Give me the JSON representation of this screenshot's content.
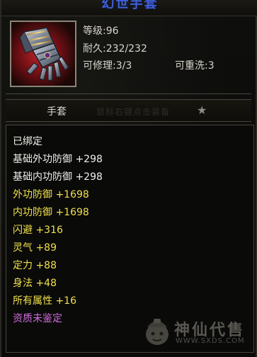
{
  "title": "幻世手套",
  "item": {
    "icon": "armored-gauntlet-icon",
    "level": "等级:96",
    "durability": "耐久:232/232",
    "repairable": "可修理:3/3",
    "rewashable": "可重洗:3"
  },
  "name_row": {
    "label": "手套",
    "hint": "鼠标右键点击装备",
    "star": "★"
  },
  "attributes": [
    {
      "text": "已绑定",
      "color": "#f0efe8"
    },
    {
      "text": "基础外功防御 +298",
      "color": "#f0efe8"
    },
    {
      "text": "基础内功防御 +298",
      "color": "#f0efe8"
    },
    {
      "text": "外功防御 +1698",
      "color": "#f0e04a"
    },
    {
      "text": "内功防御 +1698",
      "color": "#f0e04a"
    },
    {
      "text": "闪避 +316",
      "color": "#f0e04a"
    },
    {
      "text": "灵气 +89",
      "color": "#f0e04a"
    },
    {
      "text": "定力 +88",
      "color": "#f0e04a"
    },
    {
      "text": "身法 +48",
      "color": "#f0e04a"
    },
    {
      "text": "所有属性 +16",
      "color": "#f0e04a"
    },
    {
      "text": "资质未鉴定",
      "color": "#d46be0"
    }
  ],
  "watermark": {
    "text": "神仙代售",
    "url": "WWW.SXDS.COM"
  }
}
